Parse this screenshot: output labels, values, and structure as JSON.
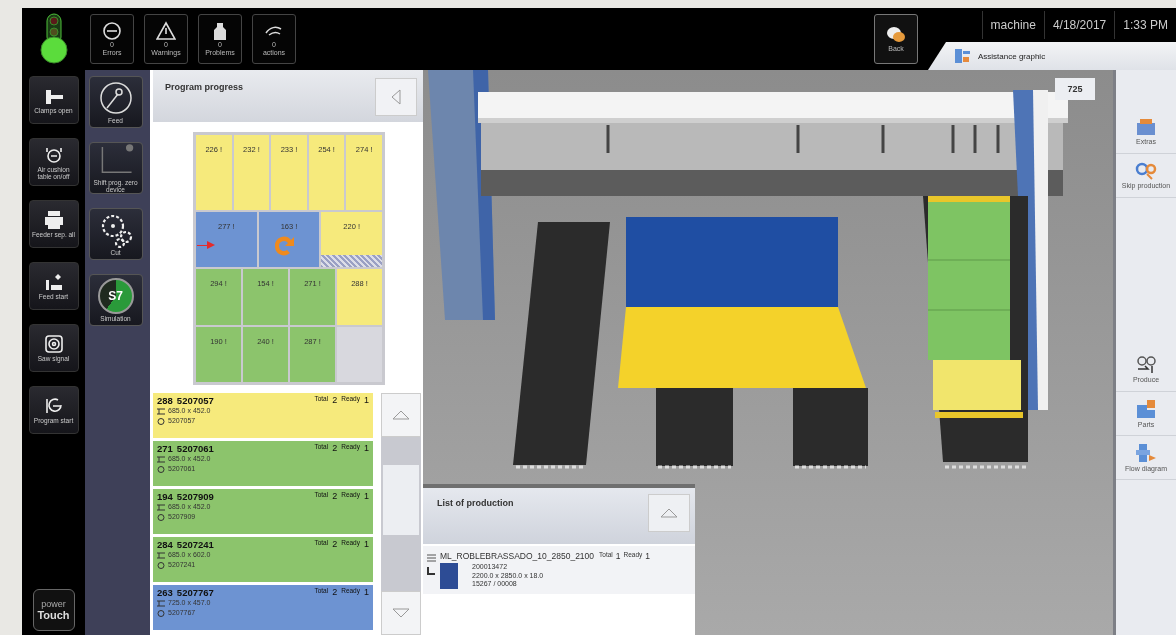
{
  "status_light": {
    "red": false,
    "yellow": false,
    "green": true
  },
  "top_buttons": [
    {
      "count": "0",
      "label": "Errors"
    },
    {
      "count": "0",
      "label": "Warnings"
    },
    {
      "count": "0",
      "label": "Problems"
    },
    {
      "count": "0",
      "label": "actions"
    }
  ],
  "back_button": {
    "label": "Back"
  },
  "header": {
    "user": "machine",
    "date": "4/18/2017",
    "time": "1:33 PM"
  },
  "view_tab": {
    "label": "Assistance graphic",
    "selected": true
  },
  "left_toolbar": [
    {
      "label": "Clamps open"
    },
    {
      "label": "Air cushion table on/off"
    },
    {
      "label": "Feeder sep. all"
    },
    {
      "label": "Feed start"
    },
    {
      "label": "Saw signal"
    },
    {
      "label": "Program start"
    }
  ],
  "logo": {
    "line1": "power",
    "line2": "Touch"
  },
  "tool_panel": [
    {
      "label": "Feed"
    },
    {
      "label": "Shift prog. zero device"
    },
    {
      "label": "Cut"
    },
    {
      "label": "Simulation",
      "badge": "S7"
    }
  ],
  "program_progress": {
    "title": "Program progress",
    "layout": [
      [
        {
          "label": "226 !",
          "color": "#f6ea7c"
        },
        {
          "label": "232 !",
          "color": "#f6ea7c"
        },
        {
          "label": "233 !",
          "color": "#f6ea7c"
        },
        {
          "label": "254 !",
          "color": "#f6ea7c"
        },
        {
          "label": "274 !",
          "color": "#f6ea7c"
        }
      ],
      [
        {
          "label": "277 !",
          "color": "#6d93d2",
          "current": false,
          "hatched": false
        },
        {
          "label": "163 !",
          "color": "#6d93d2",
          "current": true,
          "hatched": false
        },
        {
          "label": "220 !",
          "color": "#f6ea7c",
          "current": false,
          "hatched": true
        }
      ],
      [
        {
          "label": "294 !",
          "color": "#8cc46c"
        },
        {
          "label": "154 !",
          "color": "#8cc46c"
        },
        {
          "label": "271 !",
          "color": "#8cc46c"
        },
        {
          "label": "288 !",
          "color": "#f6ea7c"
        }
      ],
      [
        {
          "label": "190 !",
          "color": "#8cc46c"
        },
        {
          "label": "240 !",
          "color": "#8cc46c"
        },
        {
          "label": "287 !",
          "color": "#8cc46c"
        },
        {
          "color": "#d8d8de"
        }
      ]
    ],
    "parts": [
      {
        "number": "288",
        "code": "5207057",
        "total_label": "Total",
        "total": "2",
        "ready_label": "Ready",
        "ready": "1",
        "size": "685.0 x 452.0",
        "ref": "5207057",
        "color": "#f6ea7c"
      },
      {
        "number": "271",
        "code": "5207061",
        "total_label": "Total",
        "total": "2",
        "ready_label": "Ready",
        "ready": "1",
        "size": "685.0 x 452.0",
        "ref": "5207061",
        "color": "#8cc46c"
      },
      {
        "number": "194",
        "code": "5207909",
        "total_label": "Total",
        "total": "2",
        "ready_label": "Ready",
        "ready": "1",
        "size": "685.0 x 452.0",
        "ref": "5207909",
        "color": "#8cc46c"
      },
      {
        "number": "284",
        "code": "5207241",
        "total_label": "Total",
        "total": "2",
        "ready_label": "Ready",
        "ready": "1",
        "size": "685.0 x 602.0",
        "ref": "5207241",
        "color": "#8cc46c"
      },
      {
        "number": "263",
        "code": "5207767",
        "total_label": "Total",
        "total": "2",
        "ready_label": "Ready",
        "ready": "1",
        "size": "725.0 x 457.0",
        "ref": "5207767",
        "color": "#6d93d2"
      }
    ]
  },
  "scene": {
    "counter": "725"
  },
  "production_list": {
    "title": "List of production",
    "items": [
      {
        "name": "ML_ROBLEBRASSADO_10_2850_2100",
        "total_label": "Total",
        "total": "1",
        "ready_label": "Ready",
        "ready": "1",
        "lines": [
          "200013472",
          "2200.0 x 2850.0 x 18.0",
          "15267 / 00008"
        ]
      }
    ]
  },
  "right_panel": [
    {
      "label": "Extras"
    },
    {
      "label": "Skip production"
    },
    {
      "label": "Produce"
    },
    {
      "label": "Parts"
    },
    {
      "label": "Flow diagram"
    }
  ]
}
